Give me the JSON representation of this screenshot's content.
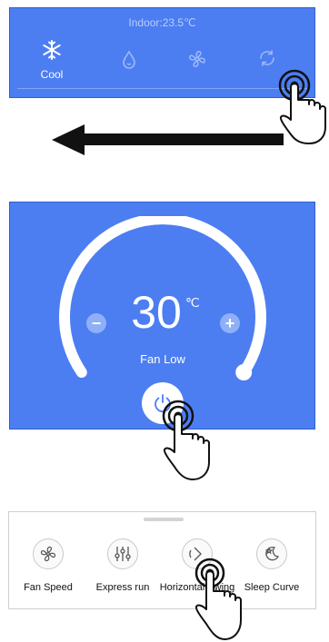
{
  "mode_panel": {
    "indoor_text": "Indoor:23.5℃",
    "modes": [
      {
        "label": "Cool",
        "icon": "snowflake-icon",
        "active": true
      },
      {
        "label": "",
        "icon": "water-drop-icon",
        "active": false
      },
      {
        "label": "",
        "icon": "fan-icon",
        "active": false
      },
      {
        "label": "",
        "icon": "auto-cycle-icon",
        "active": false
      }
    ]
  },
  "thermostat": {
    "temperature": "30",
    "unit": "℃",
    "fan_mode": "Fan Low",
    "minus_label": "−",
    "plus_label": "+"
  },
  "functions": {
    "items": [
      {
        "label": "Fan Speed",
        "icon": "fan-speed-icon"
      },
      {
        "label": "Express run",
        "icon": "sliders-icon"
      },
      {
        "label": "Horizontal Swing",
        "icon": "horizontal-swing-icon"
      },
      {
        "label": "Sleep Curve",
        "icon": "sleep-curve-icon"
      }
    ]
  },
  "colors": {
    "panel_blue": "#4c7ef2",
    "arc": "#ffffff",
    "accent_btn": "#8fb0f8"
  }
}
